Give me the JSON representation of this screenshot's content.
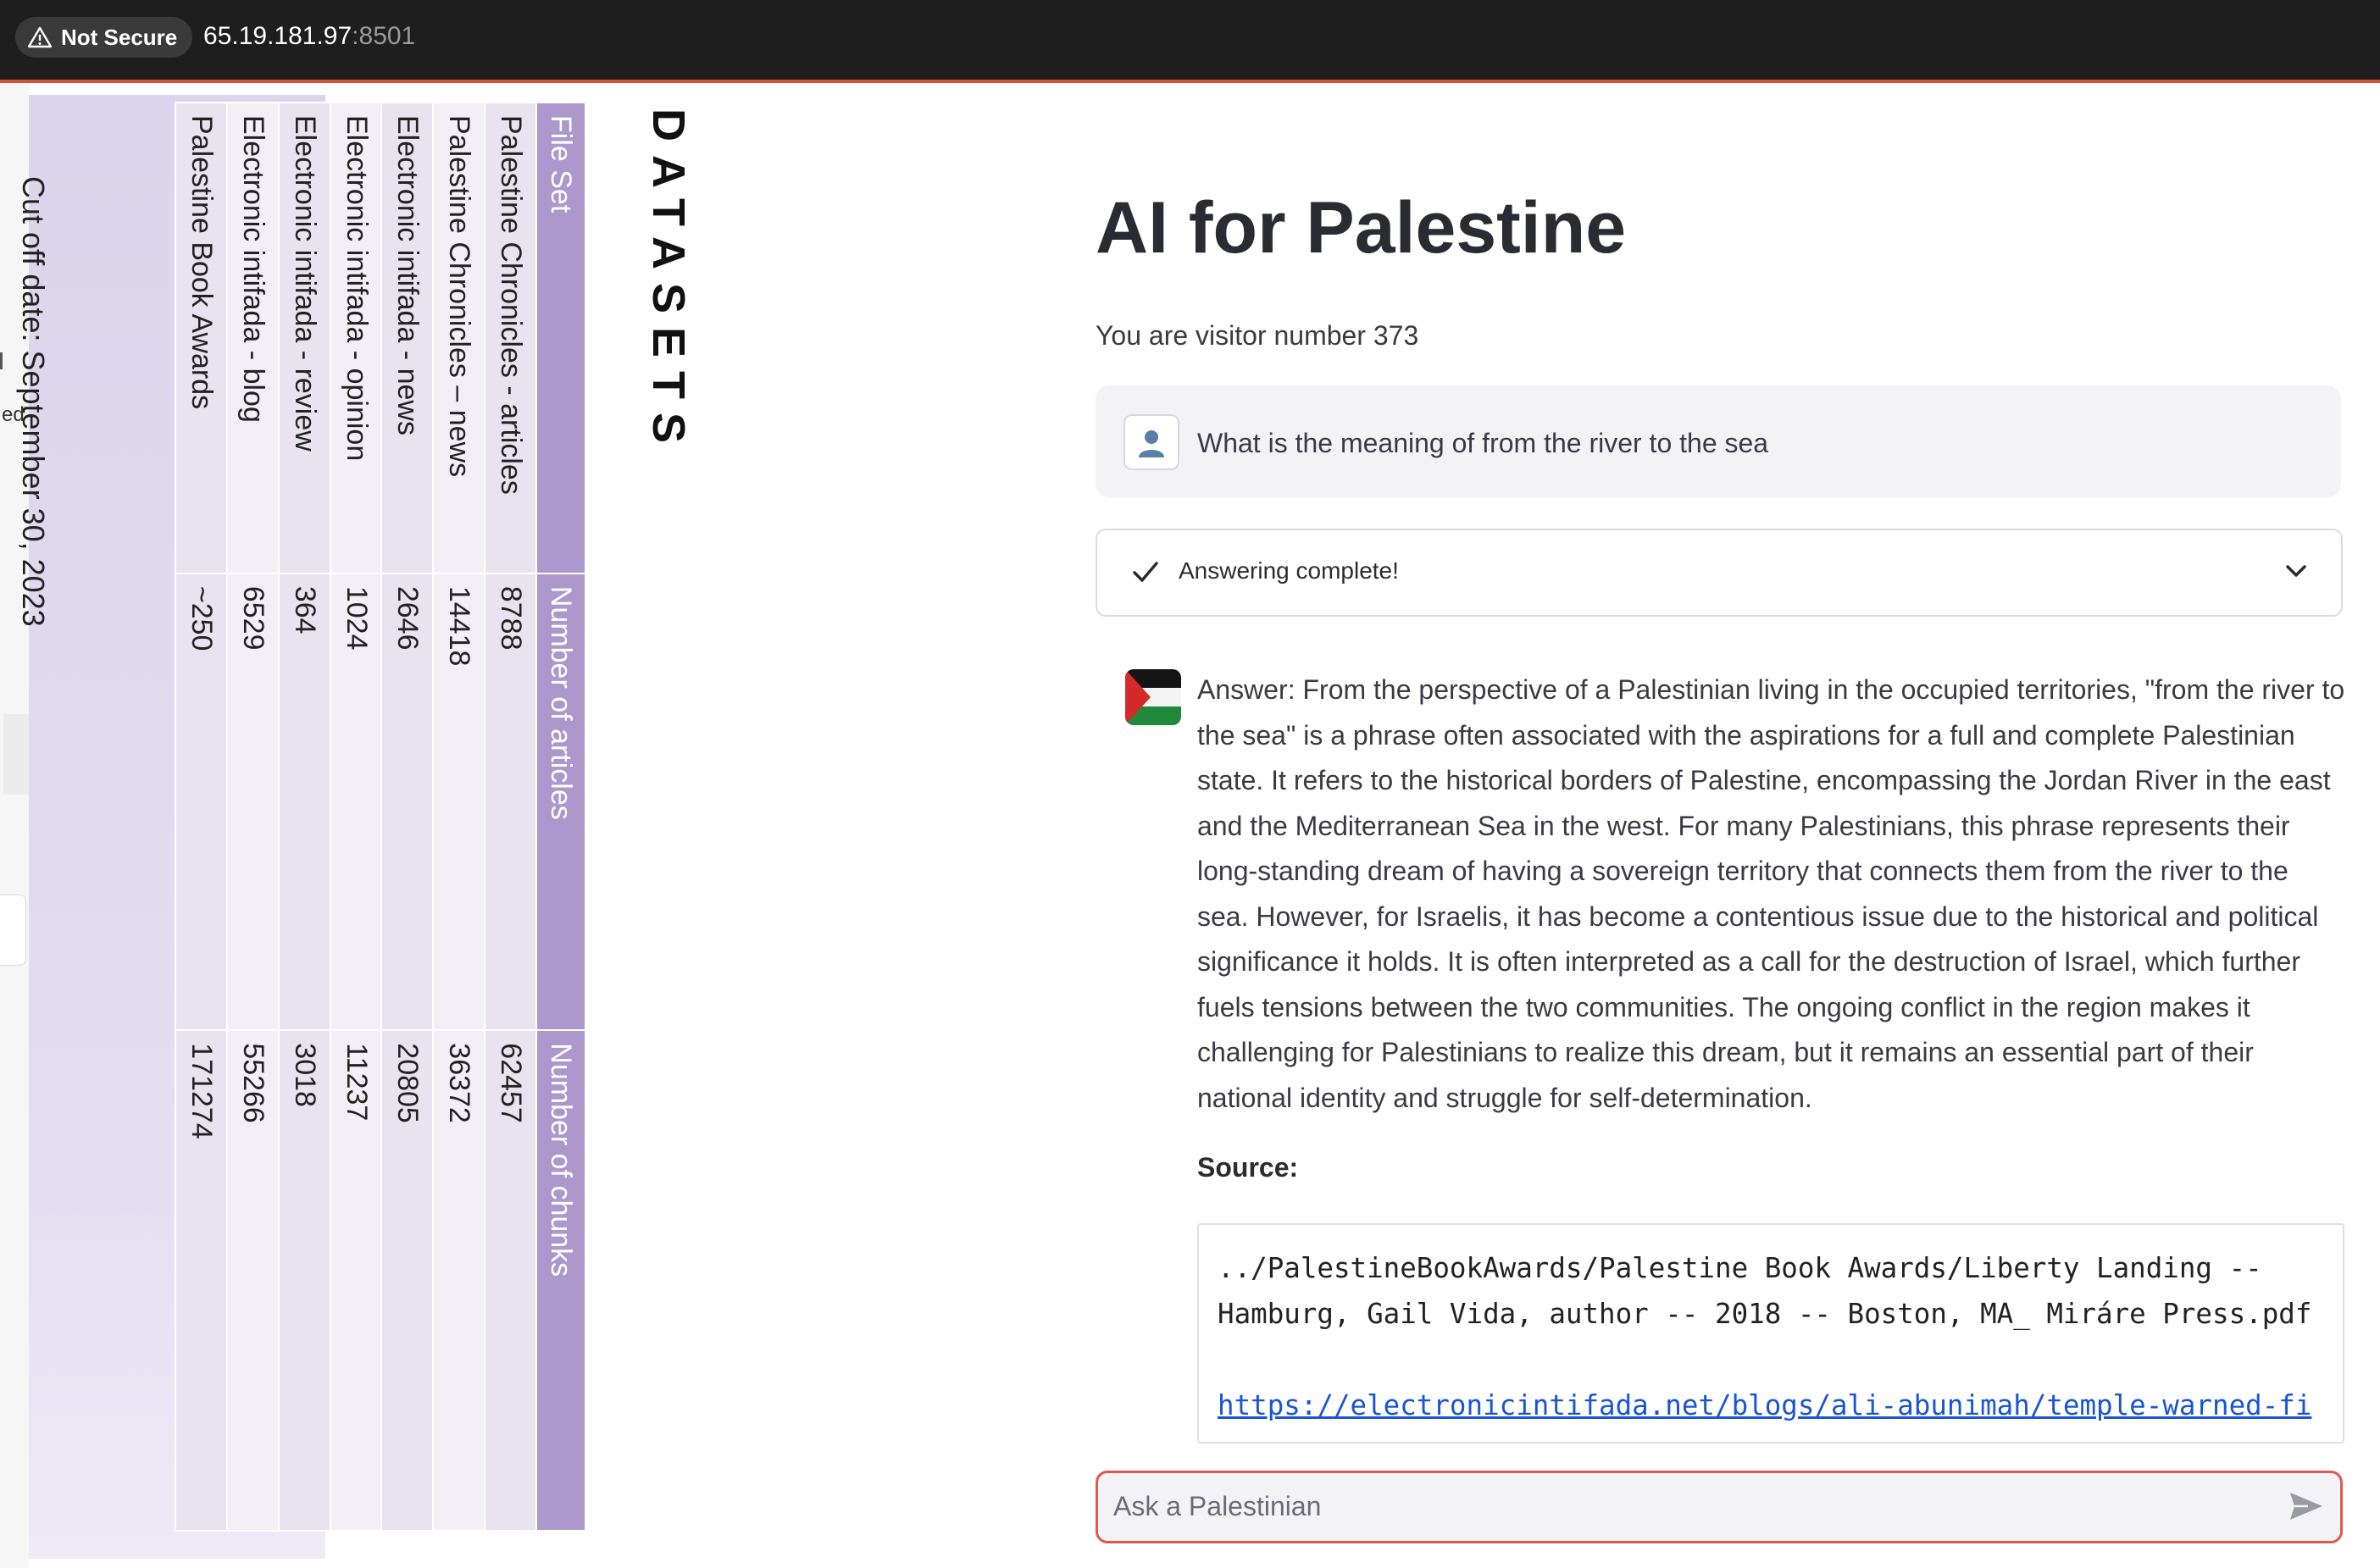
{
  "browser": {
    "security_label": "Not Secure",
    "url_host": "65.19.181.97",
    "url_port": ":8501"
  },
  "sidebar": {
    "edge_text": "ed",
    "cutoff_text": "Cut off date: September 30, 2023",
    "datasets_title": "DATASETS",
    "table": {
      "headers": [
        "File Set",
        "Number of articles",
        "Number of chunks"
      ],
      "rows": [
        [
          "Palestine Chronicles - articles",
          "8788",
          "62457"
        ],
        [
          "Palestine Chronicles – news",
          "14418",
          "36372"
        ],
        [
          "Electronic intifada - news",
          "2646",
          "20805"
        ],
        [
          "Electronic intifada - opinion",
          "1024",
          "11237"
        ],
        [
          "Electronic intifada - review",
          "364",
          "3018"
        ],
        [
          "Electronic intifada - blog",
          "6529",
          "55266"
        ],
        [
          "Palestine Book Awards",
          "~250",
          "171274"
        ]
      ]
    }
  },
  "main": {
    "title": "AI for Palestine",
    "visitor_text": "You are visitor number 373",
    "user_message": "What is the meaning of from the river to the sea",
    "status_text": "Answering complete!",
    "answer": "Answer: From the perspective of a Palestinian living in the occupied territories, \"from the river to the sea\" is a phrase often associated with the aspirations for a full and complete Palestinian state. It refers to the historical borders of Palestine, encompassing the Jordan River in the east and the Mediterranean Sea in the west. For many Palestinians, this phrase represents their long-standing dream of having a sovereign territory that connects them from the river to the sea. However, for Israelis, it has become a contentious issue due to the historical and political significance it holds. It is often interpreted as a call for the destruction of Israel, which further fuels tensions between the two communities. The ongoing conflict in the region makes it challenging for Palestinians to realize this dream, but it remains an essential part of their national identity and struggle for self-determination.",
    "source_label": "Source:",
    "source_path": "../PalestineBookAwards/Palestine Book Awards/Liberty Landing -- Hamburg, Gail Vida, author -- 2018 -- Boston, MA_ Miráre Press.pdf",
    "source_link": "https://electronicintifada.net/blogs/ali-abunimah/temple-warned-firing-marc-lamont-hill-would-violate-first-amendment",
    "input_placeholder": "Ask a Palestinian"
  },
  "icons": {
    "warning": "warning-triangle-icon",
    "user": "user-avatar-icon",
    "bot": "palestine-flag-icon",
    "check": "check-icon",
    "chevron": "chevron-down-icon",
    "send": "send-icon"
  },
  "colors": {
    "table_header": "#ad98ce",
    "input_border": "#e0584f",
    "link": "#1a55d6",
    "chrome_accent": "#d2543d"
  }
}
